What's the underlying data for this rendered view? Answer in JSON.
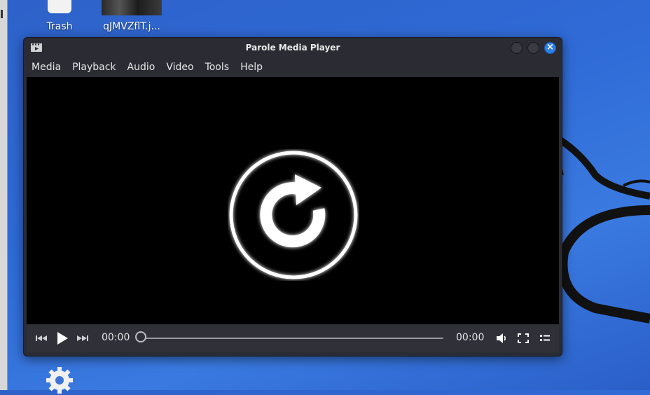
{
  "desktop": {
    "icons": [
      {
        "label": "Trash",
        "icon": "trash-icon"
      },
      {
        "label": "qJMVZflT.j...",
        "icon": "image-thumbnail"
      }
    ],
    "bottom_icon": "settings-gear-icon"
  },
  "window": {
    "title": "Parole Media Player",
    "app_icon": "film-clapper-icon",
    "buttons": {
      "minimize": "minimize-icon",
      "maximize": "maximize-icon",
      "close": "×"
    }
  },
  "menu": [
    {
      "label": "Media"
    },
    {
      "label": "Playback"
    },
    {
      "label": "Audio"
    },
    {
      "label": "Video"
    },
    {
      "label": "Tools"
    },
    {
      "label": "Help"
    }
  ],
  "video": {
    "overlay_icon": "replay-icon"
  },
  "controls": {
    "current_time": "00:00",
    "total_time": "00:00",
    "progress": 0,
    "icons": [
      "previous-track-icon",
      "play-icon",
      "next-track-icon",
      "volume-icon",
      "fullscreen-icon",
      "playlist-icon"
    ]
  },
  "colors": {
    "accent": "#2f7fe8",
    "window_bg": "#2b2c33",
    "desktop": "#2f6ad6"
  }
}
